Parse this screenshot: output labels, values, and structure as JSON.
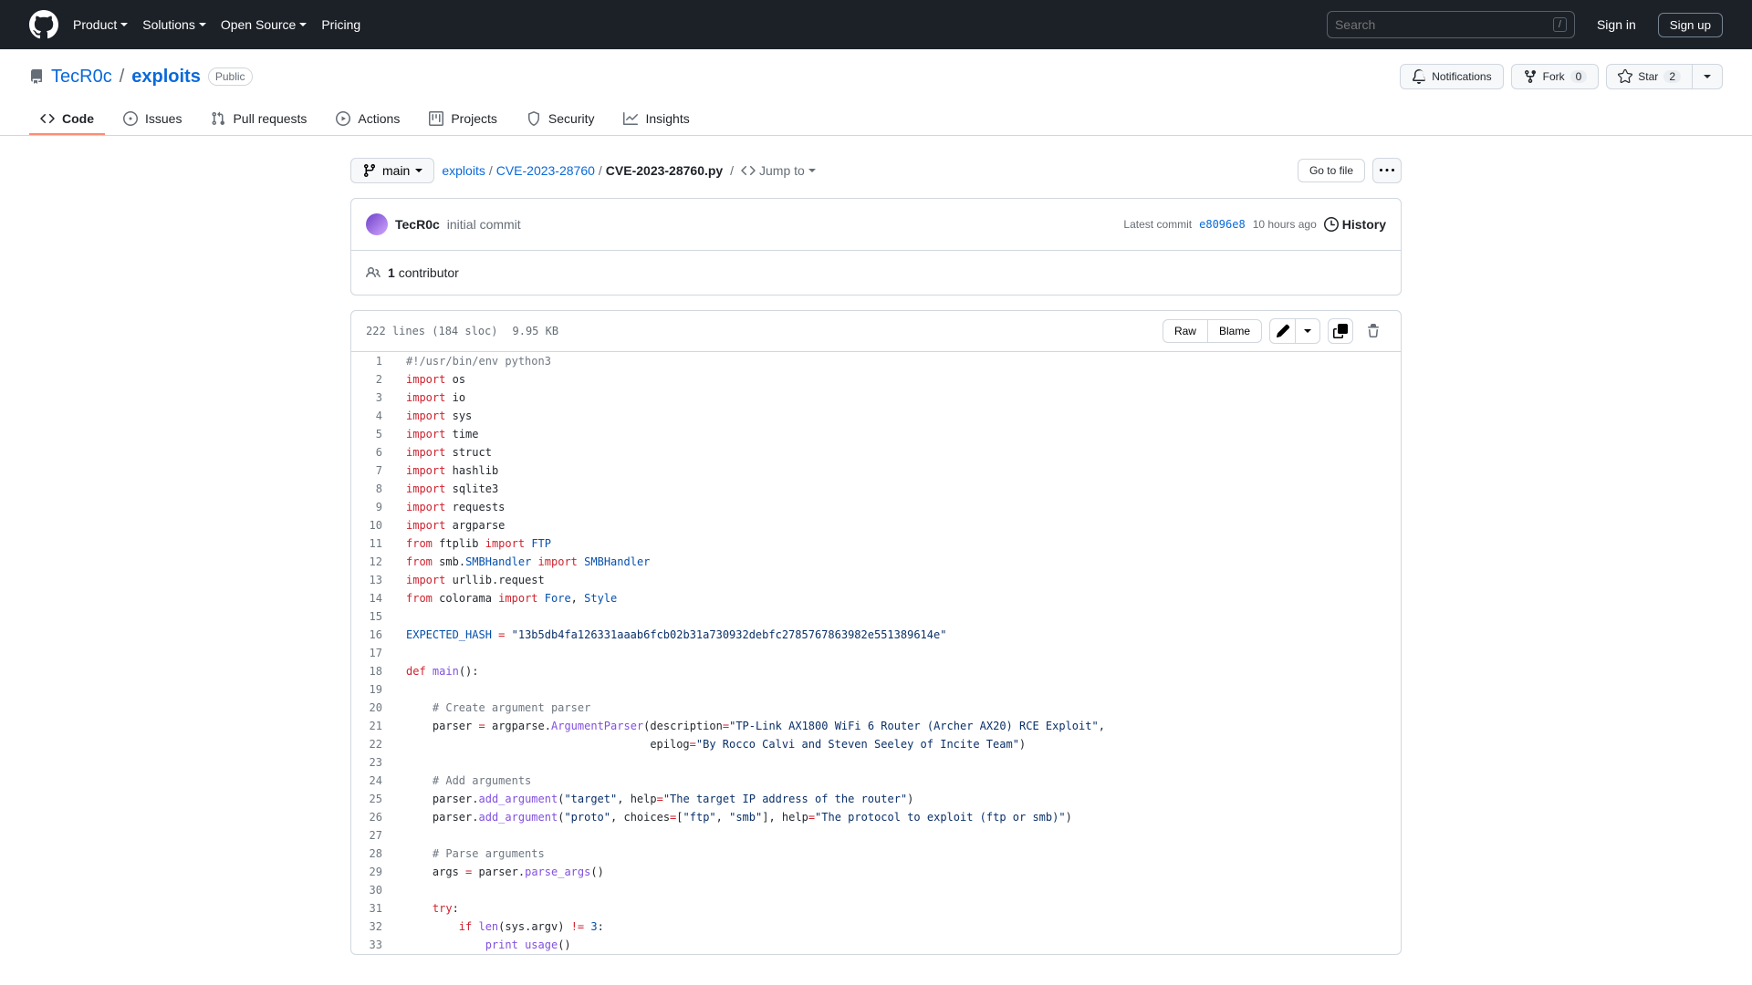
{
  "header": {
    "nav": [
      "Product",
      "Solutions",
      "Open Source",
      "Pricing"
    ],
    "search_placeholder": "Search",
    "slash": "/",
    "sign_in": "Sign in",
    "sign_up": "Sign up"
  },
  "repo": {
    "owner": "TecR0c",
    "name": "exploits",
    "visibility": "Public",
    "notifications": "Notifications",
    "fork": "Fork",
    "fork_count": "0",
    "star": "Star",
    "star_count": "2"
  },
  "tabs": {
    "code": "Code",
    "issues": "Issues",
    "pulls": "Pull requests",
    "actions": "Actions",
    "projects": "Projects",
    "security": "Security",
    "insights": "Insights"
  },
  "file_nav": {
    "branch": "main",
    "breadcrumb": [
      "exploits",
      "CVE-2023-28760",
      "CVE-2023-28760.py"
    ],
    "jump_to": "Jump to",
    "go_to_file": "Go to file"
  },
  "commit": {
    "author": "TecR0c",
    "message": "initial commit",
    "latest": "Latest commit",
    "sha": "e8096e8",
    "time": "10 hours ago",
    "history": "History",
    "contributors_count": "1",
    "contributors_label": "contributor"
  },
  "code_meta": {
    "lines": "222 lines (184 sloc)",
    "size": "9.95 KB",
    "raw": "Raw",
    "blame": "Blame"
  },
  "code": [
    {
      "n": 1,
      "html": "<span class='pl-c'>#!/usr/bin/env python3</span>"
    },
    {
      "n": 2,
      "html": "<span class='pl-k'>import</span> <span class='pl-s1'>os</span>"
    },
    {
      "n": 3,
      "html": "<span class='pl-k'>import</span> <span class='pl-s1'>io</span>"
    },
    {
      "n": 4,
      "html": "<span class='pl-k'>import</span> <span class='pl-s1'>sys</span>"
    },
    {
      "n": 5,
      "html": "<span class='pl-k'>import</span> <span class='pl-s1'>time</span>"
    },
    {
      "n": 6,
      "html": "<span class='pl-k'>import</span> <span class='pl-s1'>struct</span>"
    },
    {
      "n": 7,
      "html": "<span class='pl-k'>import</span> <span class='pl-s1'>hashlib</span>"
    },
    {
      "n": 8,
      "html": "<span class='pl-k'>import</span> <span class='pl-s1'>sqlite3</span>"
    },
    {
      "n": 9,
      "html": "<span class='pl-k'>import</span> <span class='pl-s1'>requests</span>"
    },
    {
      "n": 10,
      "html": "<span class='pl-k'>import</span> <span class='pl-s1'>argparse</span>"
    },
    {
      "n": 11,
      "html": "<span class='pl-k'>from</span> <span class='pl-s1'>ftplib</span> <span class='pl-k'>import</span> <span class='pl-c1'>FTP</span>"
    },
    {
      "n": 12,
      "html": "<span class='pl-k'>from</span> <span class='pl-s1'>smb</span>.<span class='pl-c1'>SMBHandler</span> <span class='pl-k'>import</span> <span class='pl-c1'>SMBHandler</span>"
    },
    {
      "n": 13,
      "html": "<span class='pl-k'>import</span> <span class='pl-s1'>urllib</span>.<span class='pl-s1'>request</span>"
    },
    {
      "n": 14,
      "html": "<span class='pl-k'>from</span> <span class='pl-s1'>colorama</span> <span class='pl-k'>import</span> <span class='pl-c1'>Fore</span>, <span class='pl-c1'>Style</span>"
    },
    {
      "n": 15,
      "html": ""
    },
    {
      "n": 16,
      "html": "<span class='pl-c1'>EXPECTED_HASH</span> <span class='pl-k'>=</span> <span class='pl-s'>\"13b5db4fa126331aaab6fcb02b31a730932debfc2785767863982e551389614e\"</span>"
    },
    {
      "n": 17,
      "html": ""
    },
    {
      "n": 18,
      "html": "<span class='pl-k'>def</span> <span class='pl-en'>main</span>():"
    },
    {
      "n": 19,
      "html": ""
    },
    {
      "n": 20,
      "html": "    <span class='pl-c'># Create argument parser</span>"
    },
    {
      "n": 21,
      "html": "    <span class='pl-s1'>parser</span> <span class='pl-k'>=</span> <span class='pl-s1'>argparse</span>.<span class='pl-en'>ArgumentParser</span>(<span class='pl-s1'>description</span><span class='pl-k'>=</span><span class='pl-s'>\"TP-Link AX1800 WiFi 6 Router (Archer AX20) RCE Exploit\"</span>,"
    },
    {
      "n": 22,
      "html": "                                     <span class='pl-s1'>epilog</span><span class='pl-k'>=</span><span class='pl-s'>\"By Rocco Calvi and Steven Seeley of Incite Team\"</span>)"
    },
    {
      "n": 23,
      "html": ""
    },
    {
      "n": 24,
      "html": "    <span class='pl-c'># Add arguments</span>"
    },
    {
      "n": 25,
      "html": "    <span class='pl-s1'>parser</span>.<span class='pl-en'>add_argument</span>(<span class='pl-s'>\"target\"</span>, <span class='pl-s1'>help</span><span class='pl-k'>=</span><span class='pl-s'>\"The target IP address of the router\"</span>)"
    },
    {
      "n": 26,
      "html": "    <span class='pl-s1'>parser</span>.<span class='pl-en'>add_argument</span>(<span class='pl-s'>\"proto\"</span>, <span class='pl-s1'>choices</span><span class='pl-k'>=</span>[<span class='pl-s'>\"ftp\"</span>, <span class='pl-s'>\"smb\"</span>], <span class='pl-s1'>help</span><span class='pl-k'>=</span><span class='pl-s'>\"The protocol to exploit (ftp or smb)\"</span>)"
    },
    {
      "n": 27,
      "html": ""
    },
    {
      "n": 28,
      "html": "    <span class='pl-c'># Parse arguments</span>"
    },
    {
      "n": 29,
      "html": "    <span class='pl-s1'>args</span> <span class='pl-k'>=</span> <span class='pl-s1'>parser</span>.<span class='pl-en'>parse_args</span>()"
    },
    {
      "n": 30,
      "html": ""
    },
    {
      "n": 31,
      "html": "    <span class='pl-k'>try</span>:"
    },
    {
      "n": 32,
      "html": "        <span class='pl-k'>if</span> <span class='pl-en'>len</span>(<span class='pl-s1'>sys</span>.<span class='pl-s1'>argv</span>) <span class='pl-k'>!=</span> <span class='pl-c1'>3</span>:"
    },
    {
      "n": 33,
      "html": "            <span class='pl-en'>print</span> <span class='pl-en'>usage</span>()"
    }
  ]
}
